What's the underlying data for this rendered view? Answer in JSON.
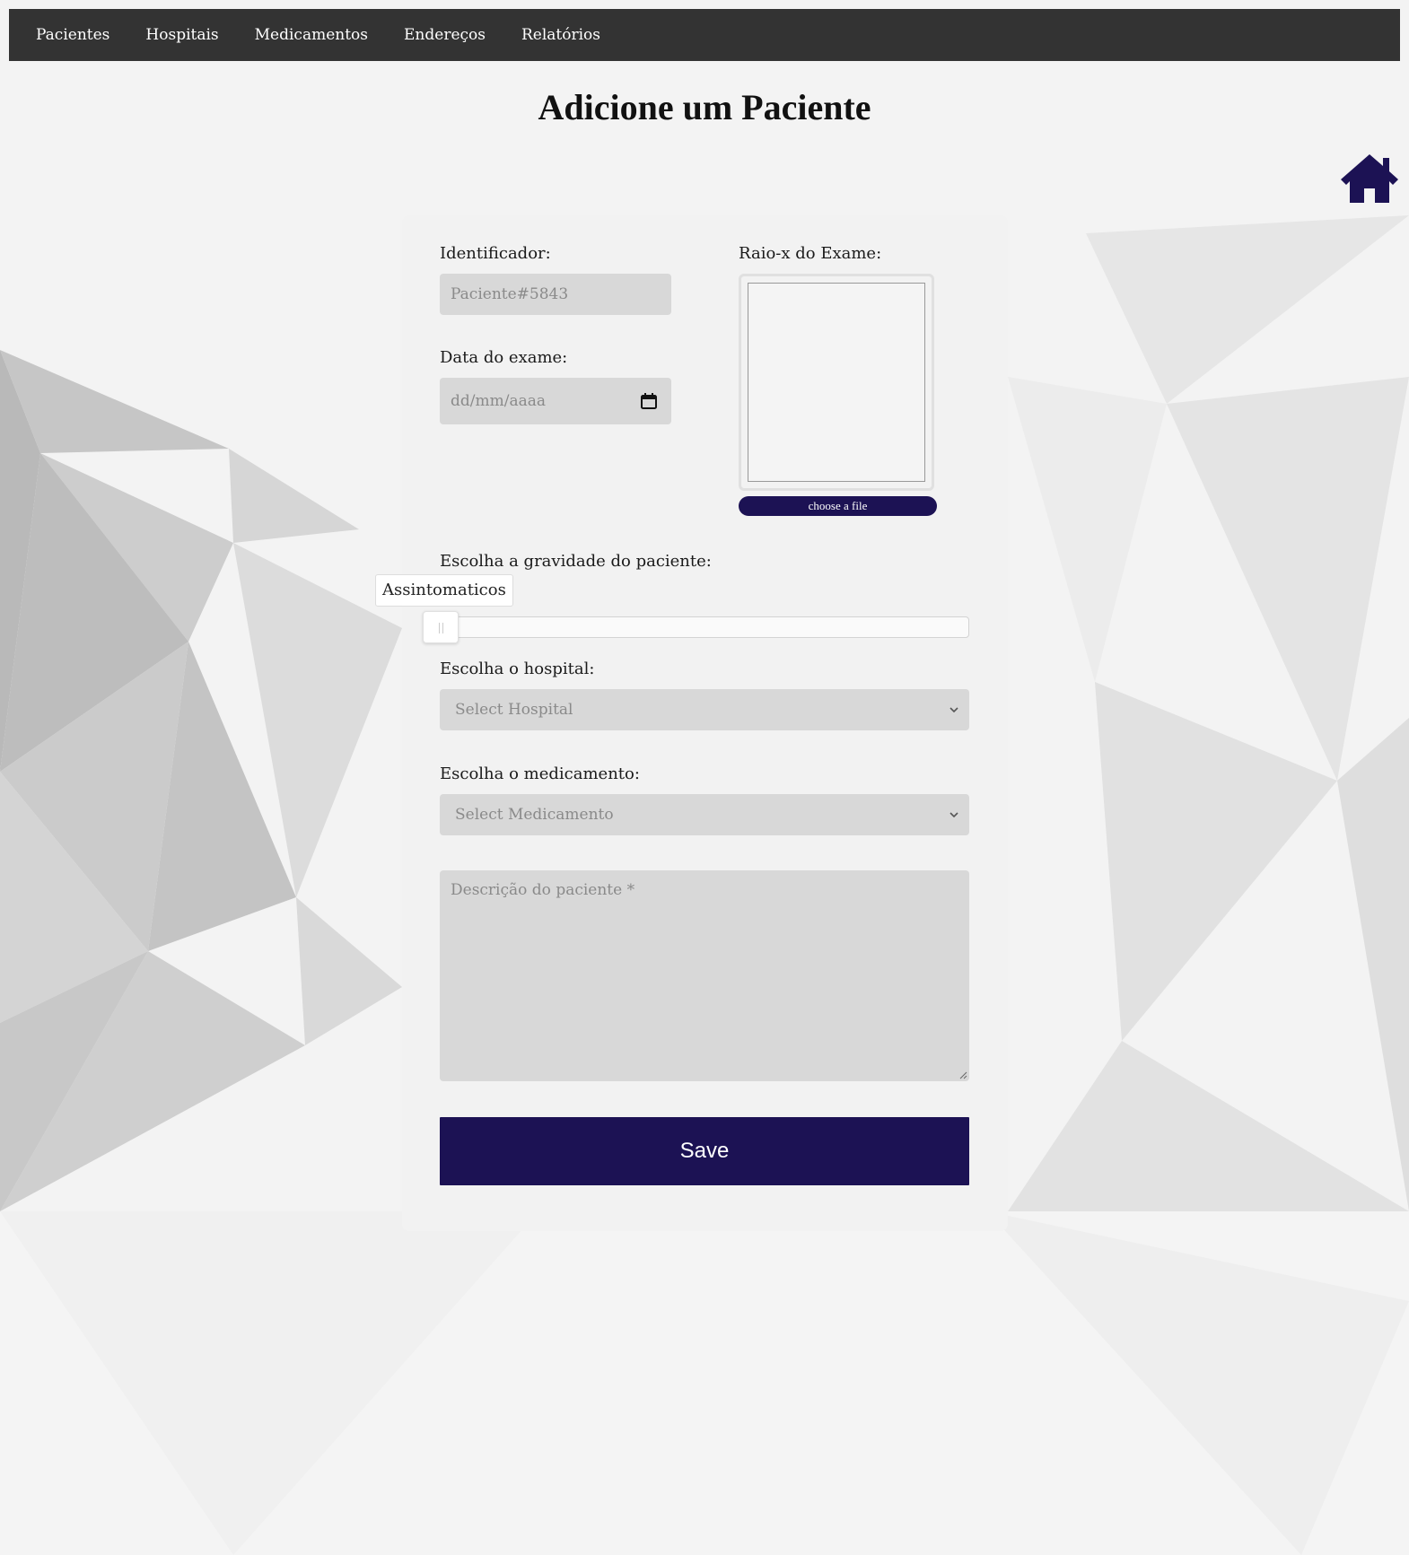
{
  "nav": {
    "items": [
      {
        "label": "Pacientes"
      },
      {
        "label": "Hospitais"
      },
      {
        "label": "Medicamentos"
      },
      {
        "label": "Endereços"
      },
      {
        "label": "Relatórios"
      }
    ]
  },
  "page": {
    "title": "Adicione um Paciente"
  },
  "home": {
    "icon": "home-icon"
  },
  "form": {
    "identifier": {
      "label": "Identificador:",
      "placeholder": "Paciente#5843"
    },
    "exam_date": {
      "label": "Data do exame:",
      "placeholder": "dd/mm/aaaa",
      "icon": "calendar-icon"
    },
    "xray": {
      "label": "Raio-x do Exame:",
      "button": "choose a file"
    },
    "severity": {
      "label": "Escolha a gravidade do paciente:",
      "value_label": "Assintomaticos",
      "position": 0
    },
    "hospital": {
      "label": "Escolha o hospital:",
      "placeholder": "Select Hospital"
    },
    "medication": {
      "label": "Escolha o medicamento:",
      "placeholder": "Select Medicamento"
    },
    "description": {
      "placeholder": "Descrição do paciente *"
    },
    "save": {
      "label": "Save"
    }
  },
  "colors": {
    "navbar": "#333333",
    "accent": "#1c1254",
    "field_bg": "#d8d8d8",
    "card_bg": "#f2f2f2"
  }
}
